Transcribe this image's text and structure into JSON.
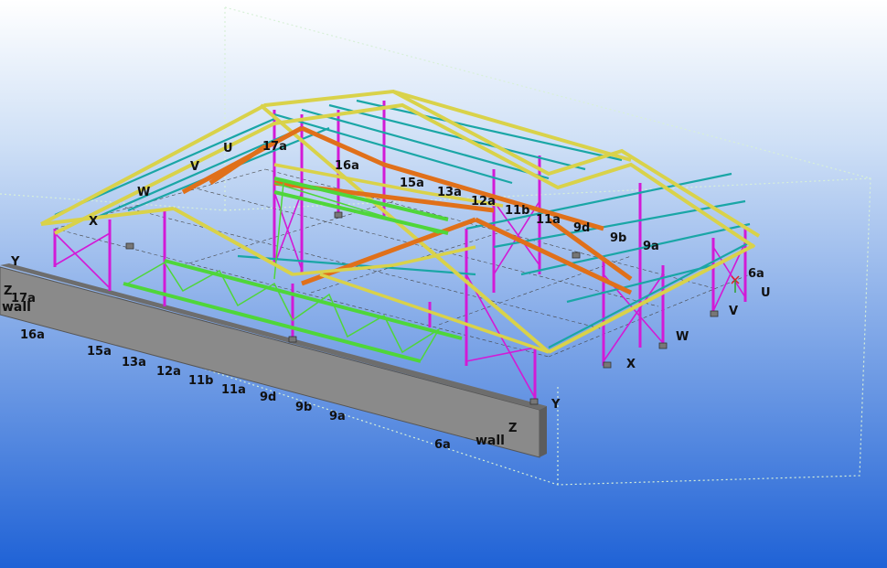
{
  "colors": {
    "background_top": "#ffffff",
    "background_bottom": "#1f62d6",
    "wall_face": "#8a8a8a",
    "wall_top": "#6d6d6d",
    "steel_yellow": "#d9d24a",
    "steel_teal": "#1aa6a6",
    "steel_orange": "#e0701a",
    "steel_magenta": "#d21ad6",
    "steel_green": "#4fd63a",
    "bounding_box": "#d8f0d8"
  },
  "model_view": {
    "grid_labels_top": [
      "U",
      "V",
      "W",
      "X",
      "Y",
      "17a",
      "16a",
      "15a",
      "13a",
      "12a",
      "11b",
      "11a",
      "9d",
      "9b",
      "9a",
      "6a"
    ],
    "grid_labels_front": [
      "16a",
      "15a",
      "13a",
      "12a",
      "11b",
      "11a",
      "9d",
      "9b",
      "9a",
      "6a",
      "17a"
    ],
    "grid_labels_side": [
      "U",
      "V",
      "W",
      "X",
      "Y",
      "Z"
    ],
    "wall_label": "wall"
  },
  "labels": {
    "top_U": "U",
    "top_V": "V",
    "top_W": "W",
    "top_X": "X",
    "top_17a": "17a",
    "top_16a": "16a",
    "top_15a": "15a",
    "top_13a": "13a",
    "top_12a": "12a",
    "top_11b": "11b",
    "top_11a": "11a",
    "top_9d": "9d",
    "top_9b": "9b",
    "top_9a": "9a",
    "top_6a": "6a",
    "right_U": "U",
    "right_V": "V",
    "right_W": "W",
    "right_X": "X",
    "right_Y": "Y",
    "left_Y": "Y",
    "left_Z": "Z",
    "left_17a": "17a",
    "front_16a": "16a",
    "front_15a": "15a",
    "front_13a": "13a",
    "front_12a": "12a",
    "front_11b": "11b",
    "front_11a": "11a",
    "front_9d": "9d",
    "front_9b": "9b",
    "front_9a": "9a",
    "front_6a": "6a",
    "wall_left": "wall",
    "wall_right": "wall",
    "wall_right_Z": "Z"
  }
}
